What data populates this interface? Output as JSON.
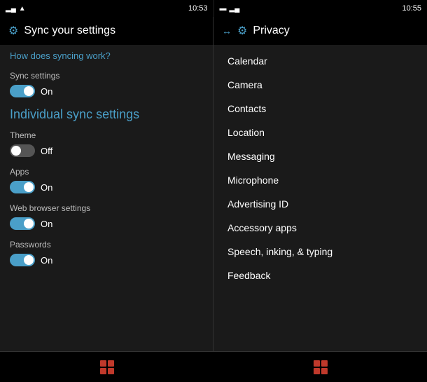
{
  "left_status": {
    "time": "10:53",
    "signal_bars": "▂▄▆",
    "wifi": "wifi"
  },
  "right_status": {
    "battery_icon": "🔋",
    "time": "10:55"
  },
  "left_panel": {
    "header": {
      "icon": "⚙",
      "title": "Sync your settings"
    },
    "how_link": "How does syncing work?",
    "sync_settings_label": "Sync settings",
    "sync_toggle": {
      "state": "on",
      "label": "On"
    },
    "individual_heading": "Individual sync settings",
    "items": [
      {
        "label": "Theme",
        "toggle_state": "off",
        "toggle_label": "Off"
      },
      {
        "label": "Apps",
        "toggle_state": "on",
        "toggle_label": "On"
      },
      {
        "label": "Web browser settings",
        "toggle_state": "on",
        "toggle_label": "On"
      },
      {
        "label": "Passwords",
        "toggle_state": "on",
        "toggle_label": "On"
      }
    ],
    "windows_icon": "⊞"
  },
  "right_panel": {
    "header": {
      "arrow": "↔",
      "icon": "⚙",
      "title": "Privacy"
    },
    "items": [
      "Calendar",
      "Camera",
      "Contacts",
      "Location",
      "Messaging",
      "Microphone",
      "Advertising ID",
      "Accessory apps",
      "Speech, inking, & typing",
      "Feedback"
    ],
    "windows_icon": "⊞"
  }
}
